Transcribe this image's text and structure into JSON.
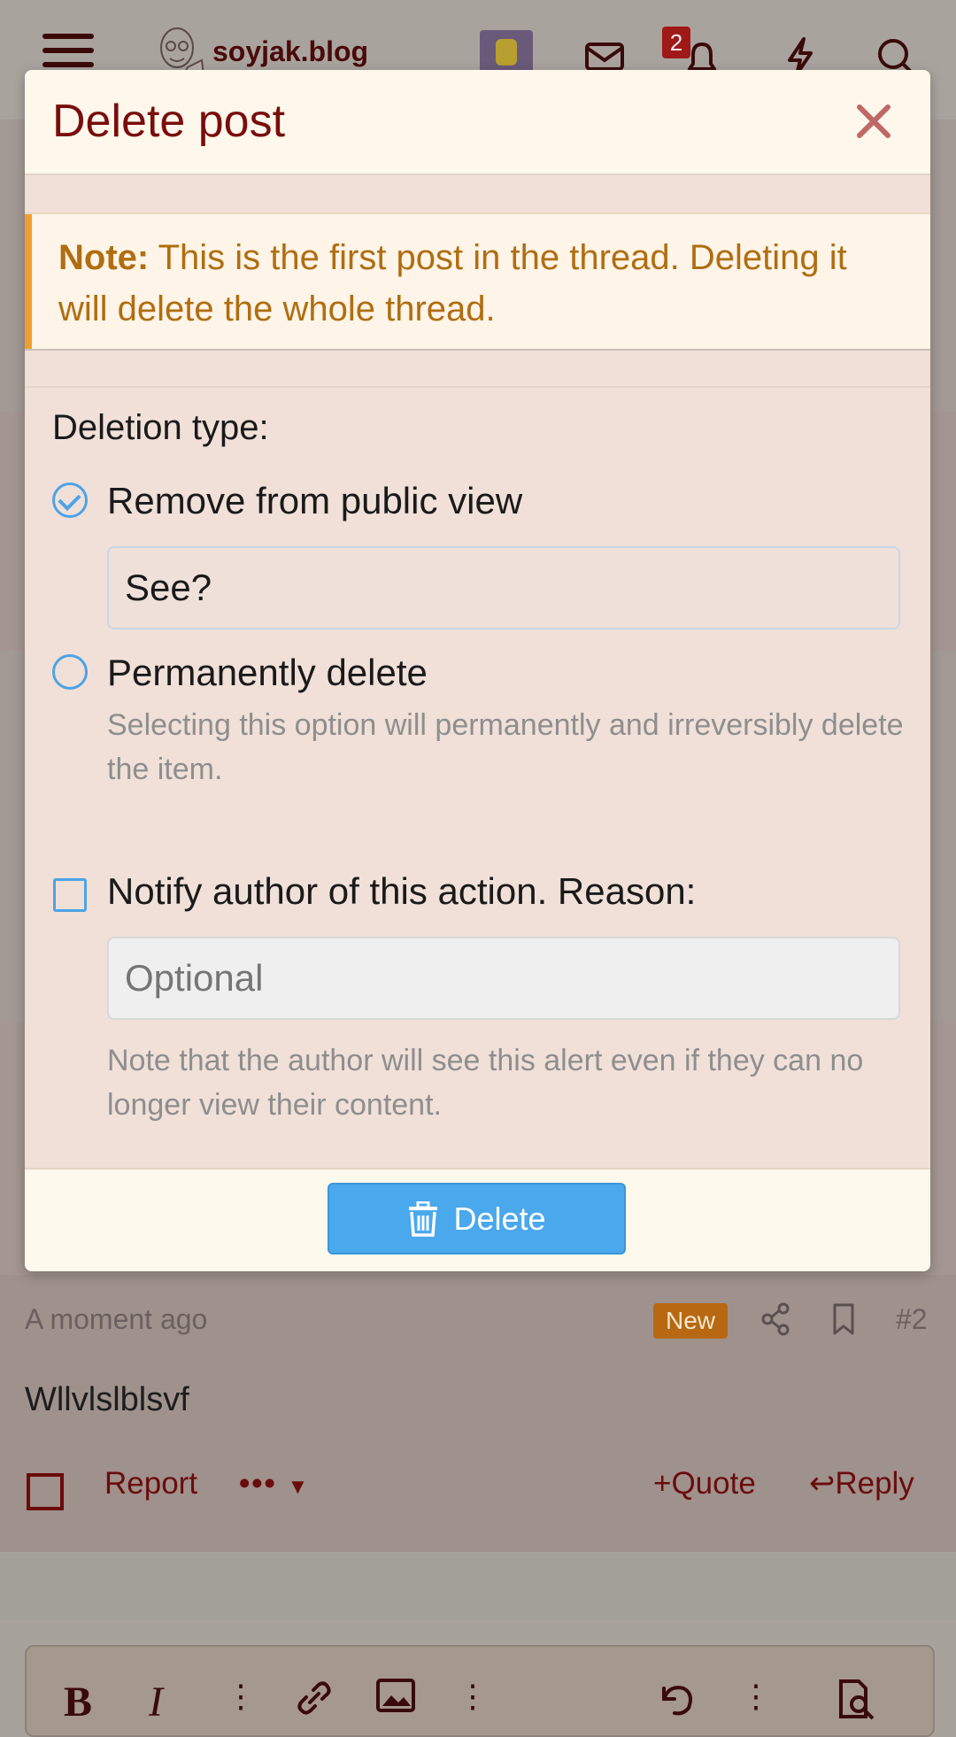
{
  "header": {
    "site_name": "soyjak.blog",
    "alerts_badge": "2",
    "icons": [
      "menu-icon",
      "logo",
      "avatar",
      "mail-icon",
      "bell-icon",
      "lightning-icon",
      "search-icon"
    ]
  },
  "dialog": {
    "title": "Delete post",
    "close_icon": "close-icon",
    "notice": {
      "label": "Note:",
      "text": "This is the first post in the thread. Deleting it will delete the whole thread."
    },
    "deletion_type_label": "Deletion type:",
    "options": [
      {
        "label": "Remove from public view",
        "checked": true
      },
      {
        "label": "Permanently delete",
        "checked": false
      }
    ],
    "reason_value": "See?",
    "permanent_hint": "Selecting this option will permanently and irreversibly delete the item.",
    "notify_label": "Notify author of this action. Reason:",
    "notify_checked": false,
    "notify_placeholder": "Optional",
    "notify_hint": "Note that the author will see this alert even if they can no longer view their content.",
    "delete_button": "Delete"
  },
  "post": {
    "time": "A moment ago",
    "new_badge": "New",
    "number": "#2",
    "body": "Wllvlslblsvf",
    "report": "Report",
    "more": "•••",
    "quote": "Quote",
    "reply": "Reply"
  },
  "editor": {
    "bold": "B",
    "italic": "I"
  },
  "colors": {
    "title": "#7a0d0d",
    "accent_blue": "#4aa8ec",
    "notice_text": "#b06e10",
    "notice_bar": "#f0a030",
    "new_badge": "#b86810"
  }
}
